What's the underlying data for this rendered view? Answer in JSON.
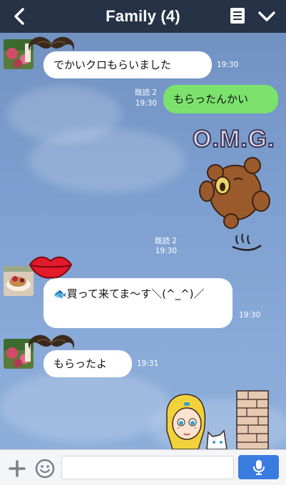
{
  "header": {
    "title": "Family (4)",
    "back_icon": "chevron-left-icon",
    "menu_icon": "list-menu-icon",
    "dropdown_icon": "chevron-down-icon"
  },
  "messages": [
    {
      "type": "incoming",
      "text": "でかいクロもらいました",
      "time": "19:30",
      "decoration": "mustache-icon"
    },
    {
      "type": "outgoing",
      "text": "もらったんかい",
      "read": "既読 2",
      "time": "19:30"
    },
    {
      "type": "sticker-outgoing",
      "sticker_text": "O.M.G.",
      "read": "既読 2",
      "time": "19:30"
    },
    {
      "type": "incoming",
      "text": "🐟買って来てま〜す＼(^_^)／",
      "time": "19:30",
      "decoration": "lips-icon"
    },
    {
      "type": "incoming",
      "text": "もらったよ",
      "time": "19:31",
      "decoration": "mustache-icon"
    }
  ],
  "composer": {
    "add_icon": "plus-icon",
    "emoji_icon": "smiley-icon",
    "placeholder": "",
    "mic_icon": "microphone-icon"
  },
  "colors": {
    "topbar": "#263246",
    "bubble_outgoing": "#7be26c",
    "bubble_incoming": "#ffffff",
    "mic_button": "#3a7be0"
  }
}
